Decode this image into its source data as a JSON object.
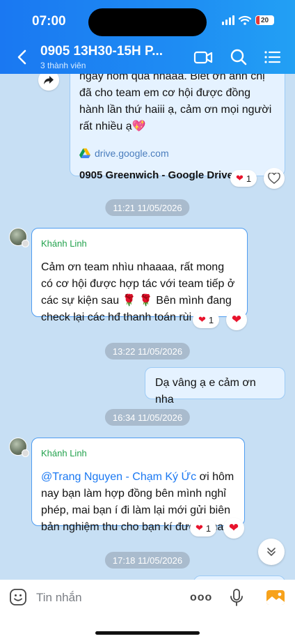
{
  "status_bar": {
    "time": "07:00",
    "battery": "20"
  },
  "header": {
    "title": "0905 13H30-15H P...",
    "subtitle": "3 thành viên",
    "icons": [
      "back-icon",
      "video-call-icon",
      "search-icon",
      "menu-icon"
    ]
  },
  "messages": {
    "m1": {
      "lines": [
        "ngày hôm qua nhaaa. Biết ơn anh chị",
        "đã cho team em cơ hội được đồng",
        "hành lần thứ haiii ạ, cảm ơn mọi người",
        "rất nhiều ạ💖"
      ],
      "link_domain": "drive.google.com",
      "link_title": "0905 Greenwich  - Google Drive",
      "reaction_count": "1"
    },
    "time1": "11:21 11/05/2026",
    "m2": {
      "sender": "Khánh Linh",
      "lines": [
        "Cảm ơn team nhìu nhaaaa, rất mong",
        "có cơ hội được hợp tác với team tiếp ở",
        "các sự kiện sau 🌹 🌹 Bên mình đang",
        "check lại các hđ thanh toán rùi nha"
      ],
      "reaction_count": "1"
    },
    "time2": "13:22 11/05/2026",
    "m3": {
      "text": "Dạ vâng ạ e cảm ơn nha"
    },
    "time3": "16:34 11/05/2026",
    "m4": {
      "sender": "Khánh Linh",
      "mention": "@Trang Nguyen - Chạm Ký Ức",
      "line1_rest": " ơi hôm",
      "lines": [
        "nay bạn làm hợp đồng bên mình nghỉ",
        "phép, mai bạn í đi làm lại mới gửi biên",
        "bản nghiệm thu cho bạn kí được nhaa"
      ],
      "reaction_count": "1"
    },
    "time4": "17:18 11/05/2026"
  },
  "input": {
    "placeholder": "Tin nhắn",
    "more": "ooo"
  },
  "colors": {
    "header": "#1a78f2",
    "accent": "#1a78f2",
    "sender": "#23a24d",
    "heart": "#e8132c"
  }
}
